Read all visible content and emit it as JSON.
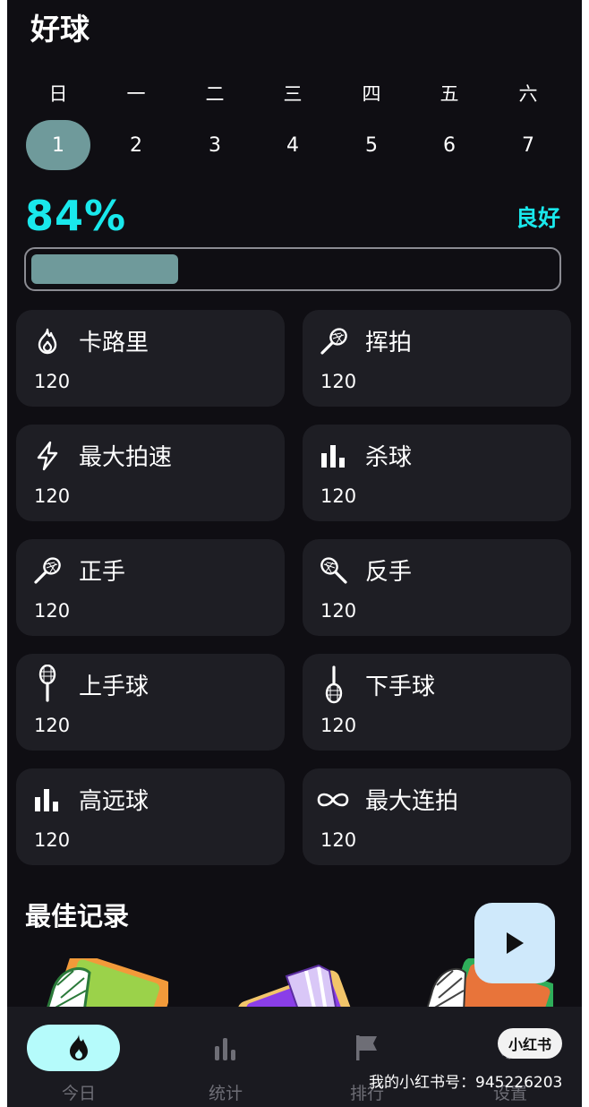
{
  "app": {
    "title": "好球"
  },
  "week": {
    "day_names": [
      "日",
      "一",
      "二",
      "三",
      "四",
      "五",
      "六"
    ],
    "dates": [
      "1",
      "2",
      "3",
      "4",
      "5",
      "6",
      "7"
    ],
    "selected_index": 0
  },
  "score": {
    "percent_label": "84%",
    "grade": "良好",
    "progress": 0.28
  },
  "stats": [
    {
      "icon": "flame-icon",
      "label": "卡路里",
      "value": "120"
    },
    {
      "icon": "racket-icon",
      "label": "挥拍",
      "value": "120"
    },
    {
      "icon": "lightning-icon",
      "label": "最大拍速",
      "value": "120"
    },
    {
      "icon": "bar-chart-icon",
      "label": "杀球",
      "value": "120"
    },
    {
      "icon": "racket-icon",
      "label": "正手",
      "value": "120"
    },
    {
      "icon": "racket-icon",
      "label": "反手",
      "value": "120"
    },
    {
      "icon": "racket-up-icon",
      "label": "上手球",
      "value": "120"
    },
    {
      "icon": "racket-down-icon",
      "label": "下手球",
      "value": "120"
    },
    {
      "icon": "bar-chart-icon",
      "label": "高远球",
      "value": "120"
    },
    {
      "icon": "infinity-icon",
      "label": "最大连拍",
      "value": "120"
    }
  ],
  "best_records": {
    "title": "最佳记录"
  },
  "tabs": [
    {
      "icon": "flame-icon",
      "label": "今日",
      "active": true
    },
    {
      "icon": "bar-chart-icon",
      "label": "统计",
      "active": false
    },
    {
      "icon": "flag-icon",
      "label": "排行",
      "active": false
    },
    {
      "icon": "gear-icon",
      "label": "设置",
      "active": false
    }
  ],
  "watermark": {
    "logo": "小红书",
    "text": "我的小红书号：945226203"
  },
  "colors": {
    "accent": "#19e8ec",
    "selected": "#6f9a9b",
    "background": "#0f0e13",
    "card": "#1e1e24"
  }
}
